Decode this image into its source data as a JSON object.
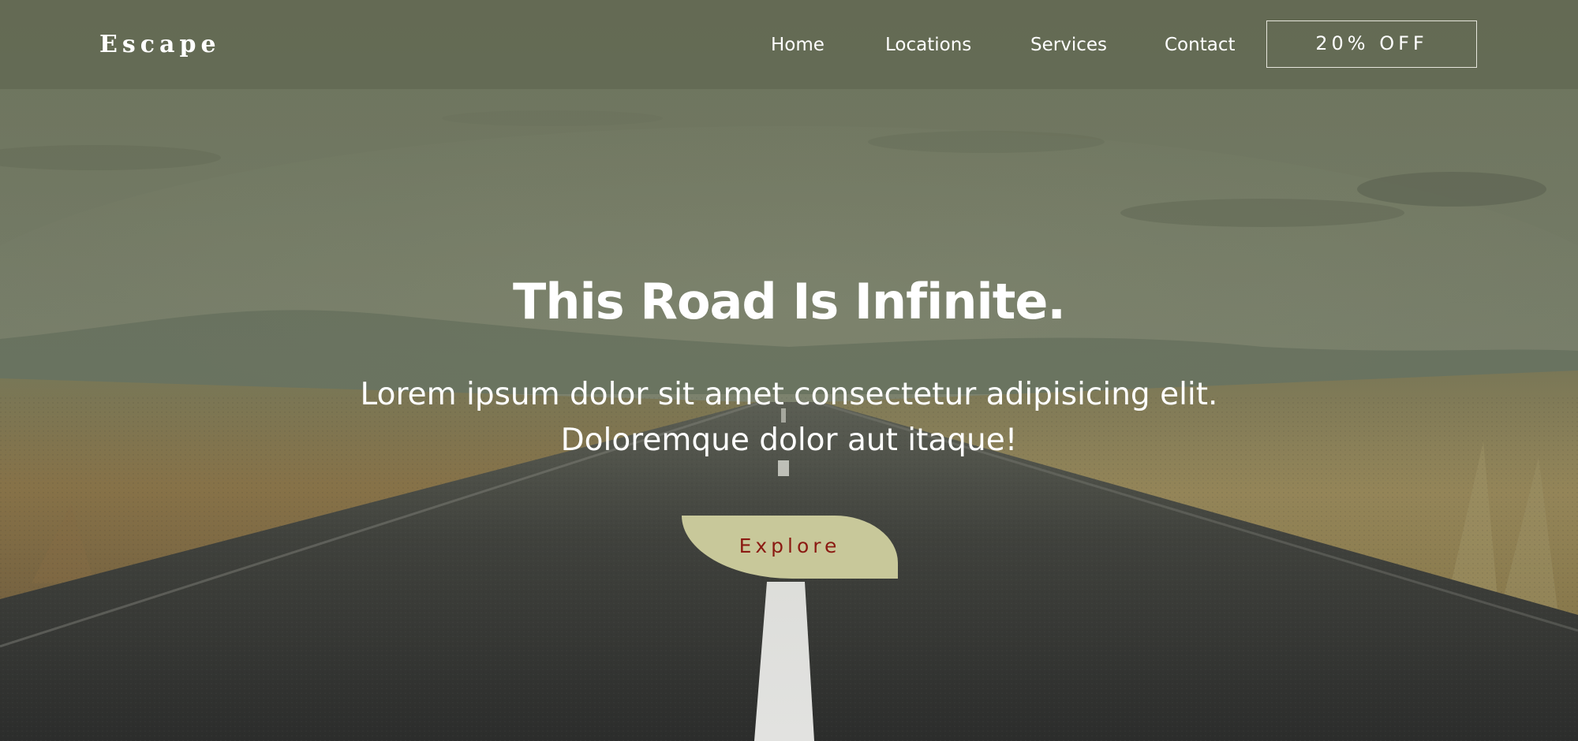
{
  "header": {
    "brand": "Escape",
    "nav": {
      "home": "Home",
      "locations": "Locations",
      "services": "Services",
      "contact": "Contact"
    },
    "offer_label": "20% OFF"
  },
  "hero": {
    "title": "This Road Is Infinite.",
    "text_line1": "Lorem ipsum dolor sit amet consectetur adipisicing elit.",
    "text_line2": "Doloremque dolor aut itaque!",
    "cta_label": "Explore"
  },
  "colors": {
    "header_bg": "#646a54",
    "cta_bg": "#c8c89a",
    "cta_text": "#8b1a12",
    "text": "#ffffff"
  }
}
